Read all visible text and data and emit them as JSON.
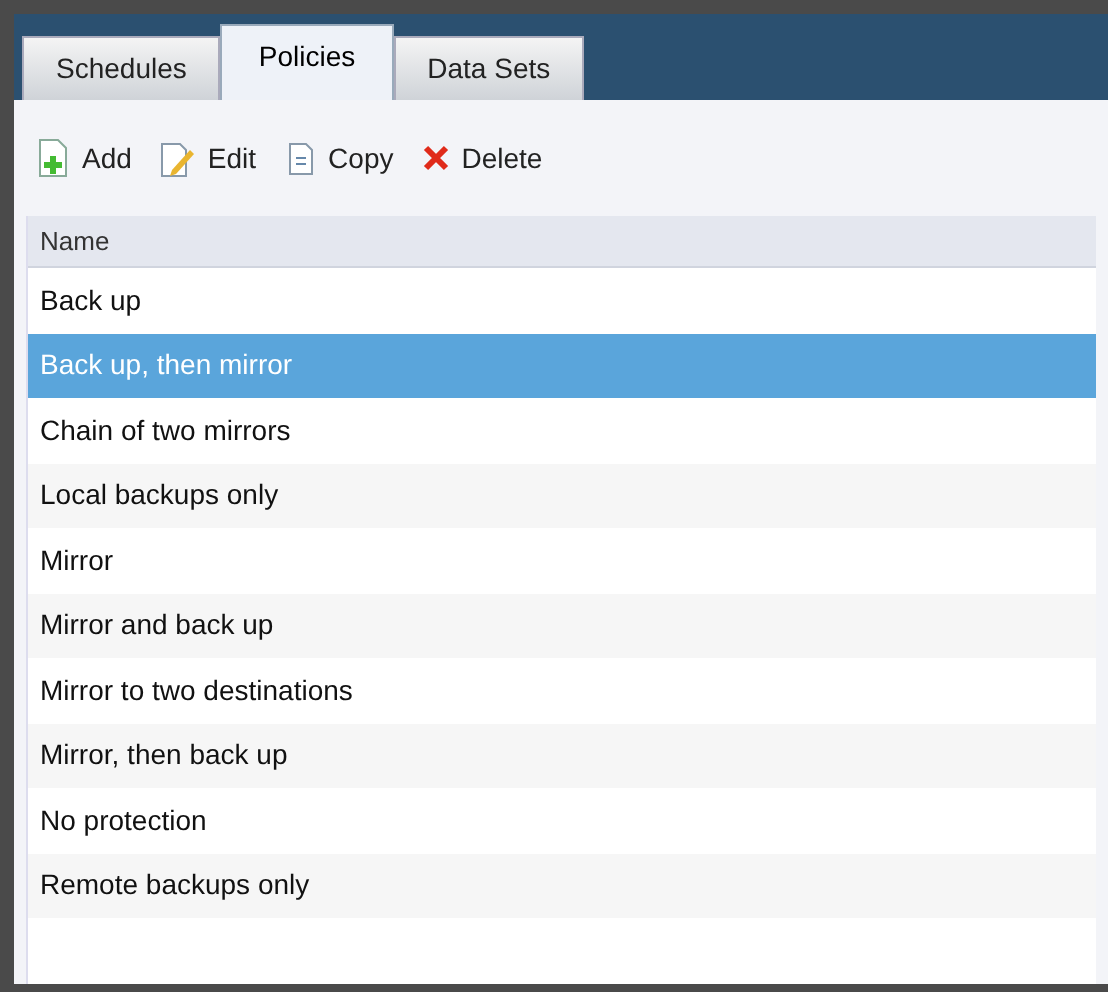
{
  "tabs": [
    {
      "label": "Schedules",
      "selected": false
    },
    {
      "label": "Policies",
      "selected": true
    },
    {
      "label": "Data Sets",
      "selected": false
    }
  ],
  "toolbar": [
    {
      "kind": "add",
      "label": "Add"
    },
    {
      "kind": "edit",
      "label": "Edit"
    },
    {
      "kind": "copy",
      "label": "Copy"
    },
    {
      "kind": "delete",
      "label": "Delete"
    }
  ],
  "table": {
    "columns": [
      "Name"
    ],
    "rows": [
      {
        "name": "Back up",
        "selected": false
      },
      {
        "name": "Back up, then mirror",
        "selected": true
      },
      {
        "name": "Chain of two mirrors",
        "selected": false
      },
      {
        "name": "Local backups only",
        "selected": false
      },
      {
        "name": "Mirror",
        "selected": false
      },
      {
        "name": "Mirror and back up",
        "selected": false
      },
      {
        "name": "Mirror to two destinations",
        "selected": false
      },
      {
        "name": "Mirror, then back up",
        "selected": false
      },
      {
        "name": "No protection",
        "selected": false
      },
      {
        "name": "Remote backups only",
        "selected": false
      }
    ]
  }
}
